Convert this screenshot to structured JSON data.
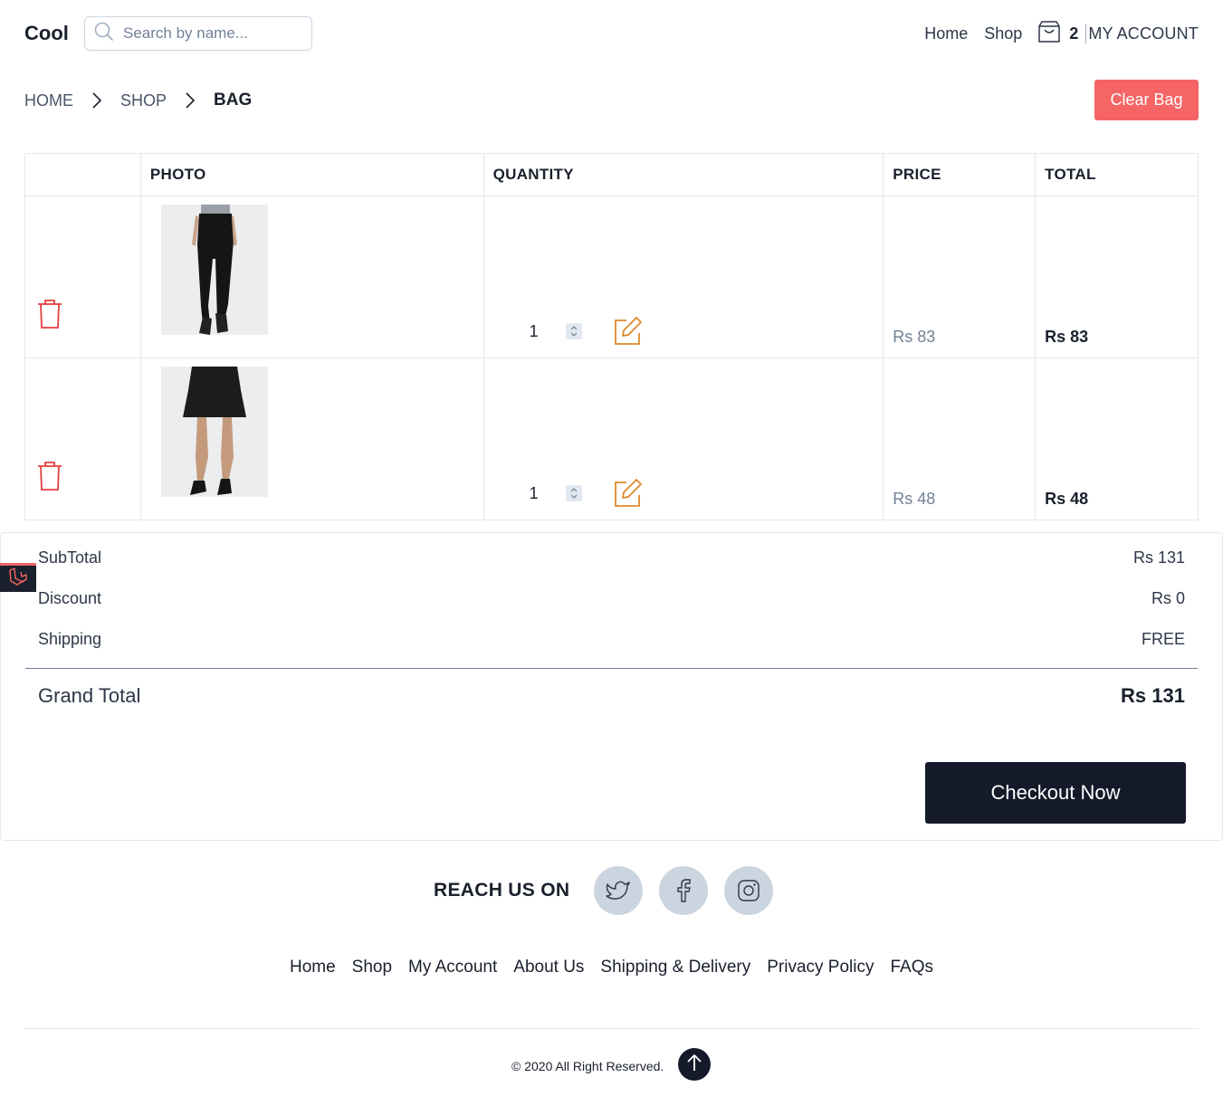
{
  "header": {
    "brand": "Cool",
    "search_placeholder": "Search by name...",
    "nav_home": "Home",
    "nav_shop": "Shop",
    "cart_count": "2",
    "account": "MY ACCOUNT"
  },
  "breadcrumb": {
    "home": "HOME",
    "shop": "SHOP",
    "current": "BAG"
  },
  "clear_bag_label": "Clear Bag",
  "table": {
    "headers": {
      "photo": "PHOTO",
      "quantity": "QUANTITY",
      "price": "PRICE",
      "total": "TOTAL"
    },
    "rows": [
      {
        "quantity": "1",
        "price": "Rs 83",
        "total": "Rs 83",
        "image": "black-jeans-product"
      },
      {
        "quantity": "1",
        "price": "Rs 48",
        "total": "Rs 48",
        "image": "black-skirt-product"
      }
    ]
  },
  "summary": {
    "subtotal_label": "SubTotal",
    "subtotal_value": "Rs 131",
    "discount_label": "Discount",
    "discount_value": "Rs 0",
    "shipping_label": "Shipping",
    "shipping_value": "FREE",
    "grand_total_label": "Grand Total",
    "grand_total_value": "Rs 131",
    "checkout_label": "Checkout Now"
  },
  "footer": {
    "reach_label": "REACH US ON",
    "social": [
      "twitter-icon",
      "facebook-icon",
      "instagram-icon"
    ],
    "links": [
      "Home",
      "Shop",
      "My Account",
      "About Us",
      "Shipping & Delivery",
      "Privacy Policy",
      "FAQs"
    ],
    "copyright": "© 2020 All Right Reserved."
  },
  "colors": {
    "danger": "#f56565",
    "dark": "#141a2a",
    "edit_icon": "#dd8a2b",
    "social_bg": "#cbd5e0"
  }
}
